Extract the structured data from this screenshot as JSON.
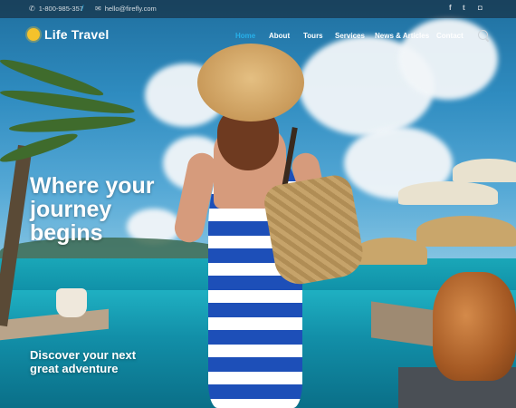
{
  "topbar": {
    "phone": "1-800-985-357",
    "email": "hello@firefly.com",
    "social": [
      "facebook-icon",
      "twitter-icon",
      "instagram-icon"
    ]
  },
  "brand": {
    "name": "Life Travel",
    "accent": "#27b0ea",
    "logo_color": "#f5c22b"
  },
  "nav": {
    "items": [
      {
        "label": "Home",
        "active": true
      },
      {
        "label": "About",
        "active": false
      },
      {
        "label": "Tours",
        "active": false
      },
      {
        "label": "Services",
        "active": false
      },
      {
        "label": "News & Articles",
        "active": false
      },
      {
        "label": "Contact",
        "active": false
      }
    ]
  },
  "hero": {
    "headline_line1": "Where your",
    "headline_line2": "journey",
    "headline_line3": "begins",
    "subline_line1": "Discover your next",
    "subline_line2": "great adventure"
  }
}
